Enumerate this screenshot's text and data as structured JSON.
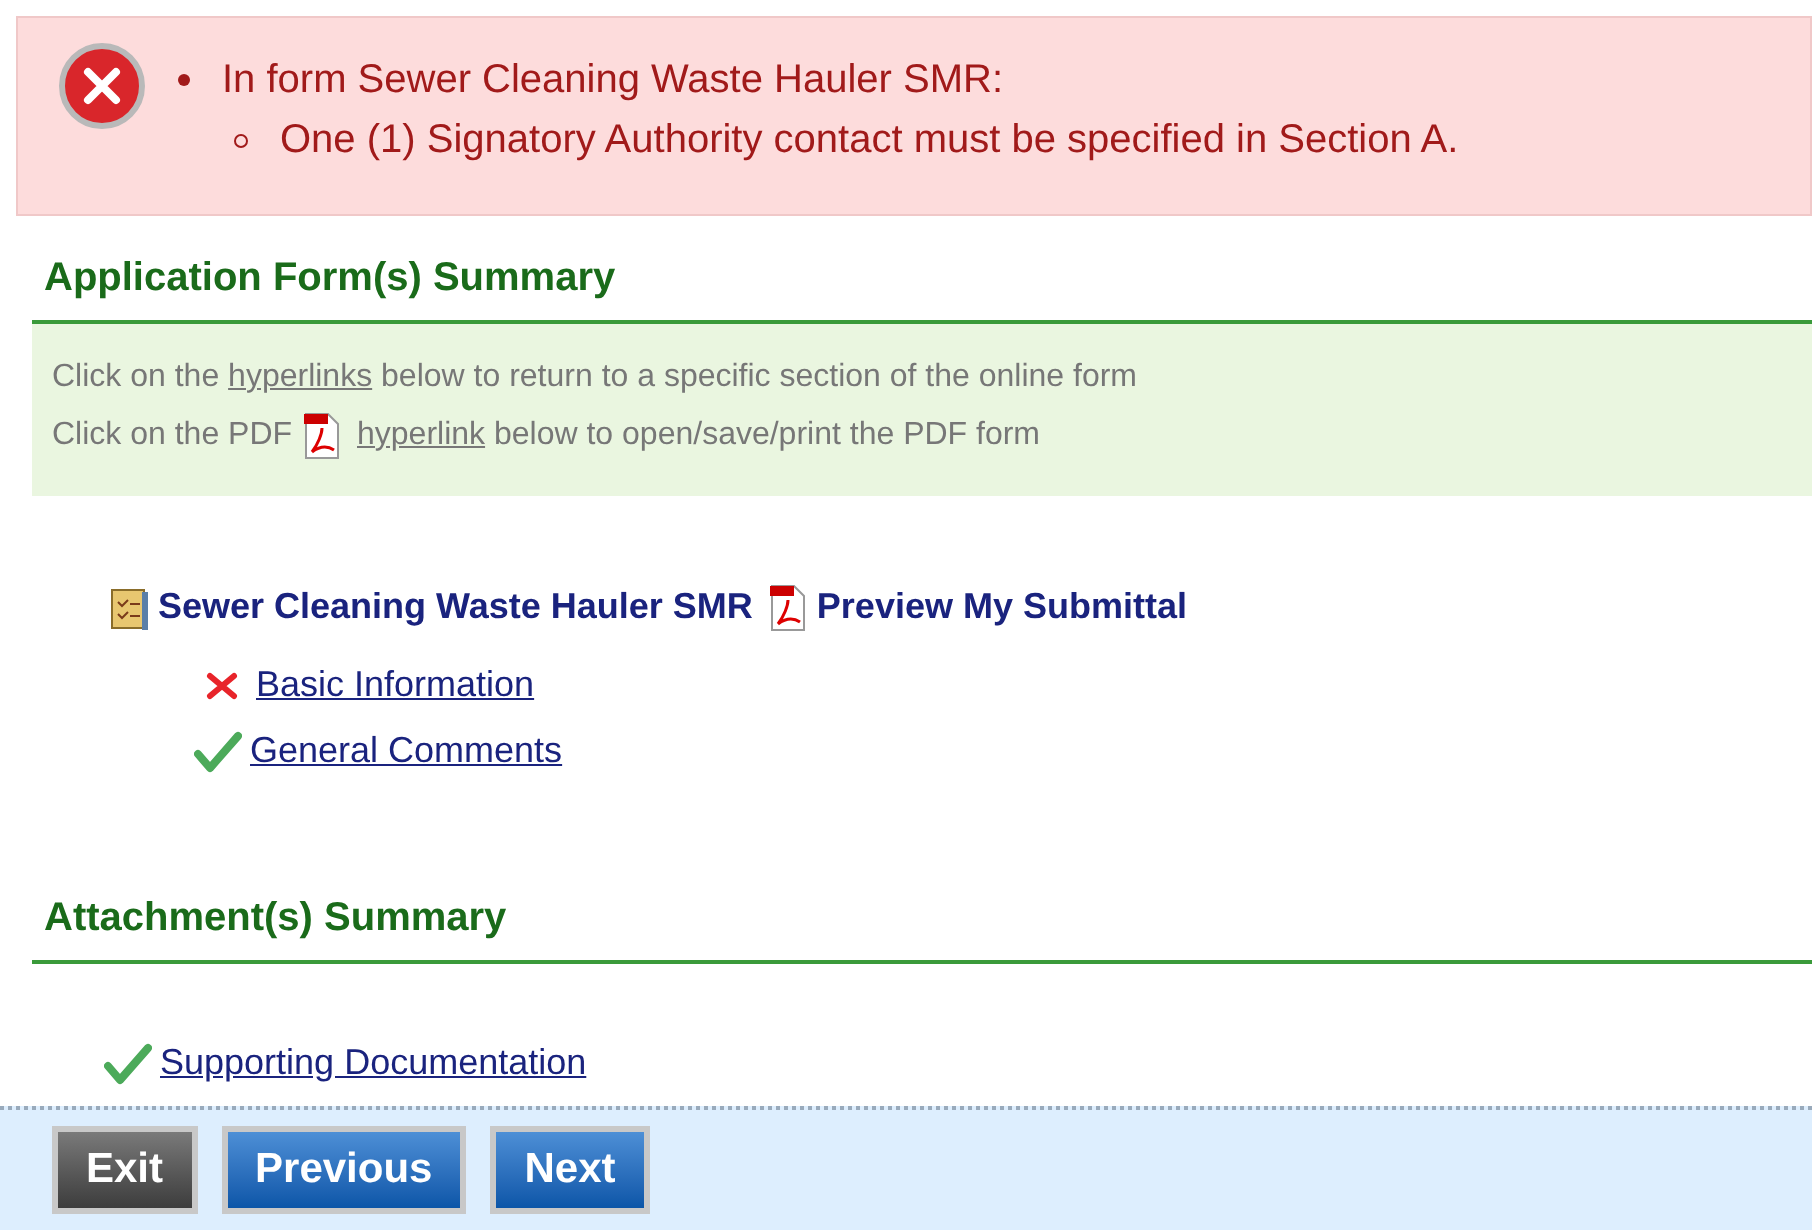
{
  "error": {
    "items": [
      {
        "text": "In form Sewer Cleaning Waste Hauler SMR:",
        "children": [
          {
            "text": "One (1) Signatory Authority contact must be specified in Section A."
          }
        ]
      }
    ]
  },
  "forms_summary": {
    "title": "Application Form(s) Summary",
    "instructions": [
      {
        "kind": "plain",
        "before": "Click on the",
        "link": "hyperlinks",
        "after": "below to return to a specific section of the online form"
      },
      {
        "kind": "pdf",
        "before": "Click on the PDF",
        "link": "hyperlink",
        "after": "below to open/save/print the PDF form"
      }
    ],
    "form": {
      "name": "Sewer Cleaning Waste Hauler SMR",
      "preview": "Preview My Submittal"
    },
    "sections": [
      {
        "label": "Basic Information",
        "complete": false
      },
      {
        "label": "General Comments",
        "complete": true
      }
    ]
  },
  "attachments_summary": {
    "title": "Attachment(s) Summary",
    "items": [
      {
        "label": "Supporting Documentation",
        "complete": true
      }
    ]
  },
  "buttons": [
    {
      "label": "Exit",
      "kind": "secondary"
    },
    {
      "label": "Previous",
      "kind": "primary"
    },
    {
      "label": "Next",
      "kind": "primary"
    }
  ]
}
